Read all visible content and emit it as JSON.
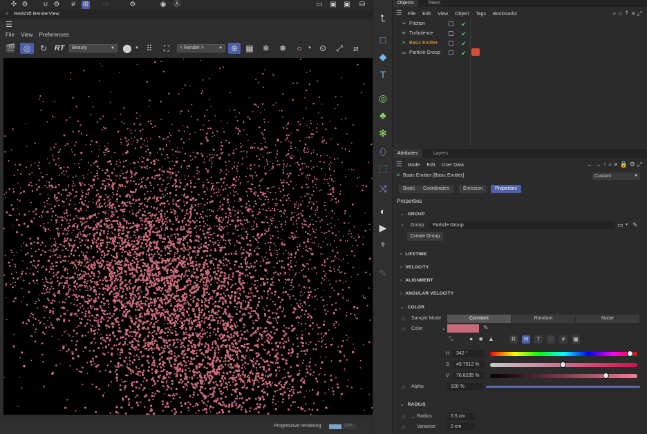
{
  "render_view": {
    "title": "Redshift RenderView",
    "close_glyph": "×",
    "menu": [
      "File",
      "View",
      "Preferences"
    ],
    "rt_label": "RT",
    "aov_select": "Beauty",
    "render_select": "< Render >",
    "status_label": "Progressive rendering",
    "progress_text": "22%",
    "progress_fraction": 0.45,
    "particle_color": "#c86a7a"
  },
  "objects_panel": {
    "tabs": [
      "Objects",
      "Takes"
    ],
    "menu": [
      "File",
      "Edit",
      "View",
      "Object",
      "Tags",
      "Bookmarks"
    ],
    "items": [
      {
        "label": "Friction",
        "icon": "friction-icon"
      },
      {
        "label": "Turbulence",
        "icon": "turbulence-icon"
      },
      {
        "label": "Basic Emitter",
        "icon": "emitter-icon",
        "selected": true
      },
      {
        "label": "Particle Group",
        "icon": "folder-icon"
      }
    ]
  },
  "attributes_panel": {
    "tabs": [
      "Attributes",
      "Layers"
    ],
    "menu": [
      "Mode",
      "Edit",
      "User Data"
    ],
    "object_name": "Basic Emitter [Basic Emitter]",
    "preset": "Custom",
    "subtabs": [
      "Basic",
      "Coordinates",
      "Emission",
      "Properties"
    ],
    "active_subtab": "Properties",
    "section_title": "Properties",
    "groups": {
      "group": "GROUP",
      "lifetime": "LIFETIME",
      "velocity": "VELOCITY",
      "alignment": "ALIGNMENT",
      "angular_velocity": "ANGULAR VELOCITY",
      "color": "COLOR",
      "radius": "RADIUS"
    },
    "group_label": "Group",
    "group_value": "Particle Group",
    "create_group_button": "Create Group",
    "sample_mode_label": "Sample Mode",
    "sample_modes": [
      "Constant",
      "Random",
      "Noise"
    ],
    "active_sample_mode": "Constant",
    "color_label": "Color",
    "color_value": "#c86a7a",
    "color_modes": [
      "R",
      "H",
      "T",
      "∷",
      "#",
      "▦"
    ],
    "active_color_mode": "H",
    "h_label": "H",
    "h_value": "342 °",
    "h_fraction": 0.95,
    "s_label": "S",
    "s_value": "49.7512 %",
    "s_fraction": 0.4975,
    "v_label": "V",
    "v_value": "78.8235 %",
    "v_fraction": 0.788,
    "alpha_label": "Alpha",
    "alpha_value": "100 %",
    "alpha_fraction": 1.0,
    "radius_label": "Radius",
    "radius_value": "0.5 cm",
    "variance_label": "Variance",
    "variance_value": "0 cm"
  }
}
